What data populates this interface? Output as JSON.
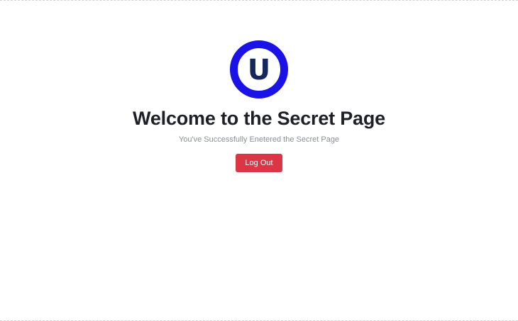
{
  "logo": {
    "letter": "U",
    "ring_color": "#1a12e6",
    "letter_color": "#14285e"
  },
  "main": {
    "title": "Welcome to the Secret Page",
    "subtitle": "You've Successfully Enetered the Secret Page"
  },
  "actions": {
    "logout_label": "Log Out",
    "logout_color": "#dc3545"
  }
}
